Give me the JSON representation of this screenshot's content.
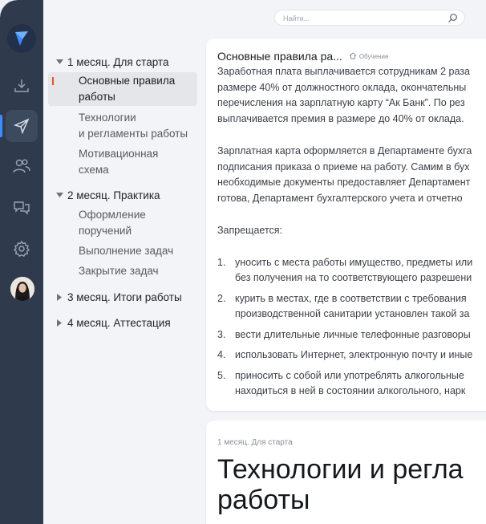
{
  "search": {
    "placeholder": "Найти..."
  },
  "tree": {
    "sections": [
      {
        "label": "1 месяц. Для старта",
        "expanded": true,
        "items": [
          "Основные правила работы",
          "Технологии и регламенты работы",
          "Мотивационная схема"
        ]
      },
      {
        "label": "2 месяц. Практика",
        "expanded": true,
        "items": [
          "Оформление поручений",
          "Выполнение задач",
          "Закрытие задач"
        ]
      },
      {
        "label": "3 месяц. Итоги работы",
        "expanded": false
      },
      {
        "label": "4 месяц. Аттестация",
        "expanded": false
      }
    ],
    "item_lines": {
      "i1a": "Основные правила",
      "i1b": "работы",
      "i2a": "Технологии",
      "i2b": "и регламенты работы",
      "i3a": "Мотивационная",
      "i3b": "схема",
      "i4a": "Оформление",
      "i4b": "поручений",
      "i5": "Выполнение задач",
      "i6": "Закрытие задач"
    }
  },
  "card1": {
    "title": "Основные правила ра...",
    "breadcrumb": "Обучение",
    "paragraph1": [
      "Заработная плата выплачивается сотрудникам 2 раза",
      "размере 40% от должностного оклада, окончательны",
      "перечисления на зарплатную карту “Ак Банк”. По рез",
      "выплачивается премия в размере до 40% от оклада."
    ],
    "paragraph2": [
      "Зарплатная карта оформляется в Департаменте бухга",
      "подписания приказа о приеме на работу. Самим в бух",
      "необходимые документы предоставляет Департамент",
      "готова, Департамент бухгалтерского учета и отчетно"
    ],
    "forbidden_label": "Запрещается:",
    "rules": [
      {
        "num": "1.",
        "lines": [
          "уносить с места работы имущество, предметы или",
          "без получения на то соответствующего разрешени"
        ]
      },
      {
        "num": "2.",
        "lines": [
          "курить в местах, где в соответствии с требования",
          "производственной санитарии установлен такой за"
        ]
      },
      {
        "num": "3.",
        "lines": [
          "вести длительные личные телефонные разговоры"
        ]
      },
      {
        "num": "4.",
        "lines": [
          "использовать Интернет, электронную почту и иные"
        ]
      },
      {
        "num": "5.",
        "lines": [
          "приносить с собой или употреблять алкогольные",
          "находиться в ней в состоянии алкогольного, нарк"
        ]
      }
    ]
  },
  "card2": {
    "breadcrumb": "1 месяц. Для старта",
    "title_line1": "Технологии и регла",
    "title_line2": "работы"
  },
  "colors": {
    "sidebar": "#2f3b4d",
    "accent": "#3d8bff",
    "active_mark": "#e05a1f"
  },
  "icons": [
    "logo-icon",
    "download-icon",
    "send-icon",
    "users-icon",
    "chat-icon",
    "gear-icon",
    "search-icon",
    "home-icon",
    "caret-down-icon",
    "caret-right-icon"
  ]
}
